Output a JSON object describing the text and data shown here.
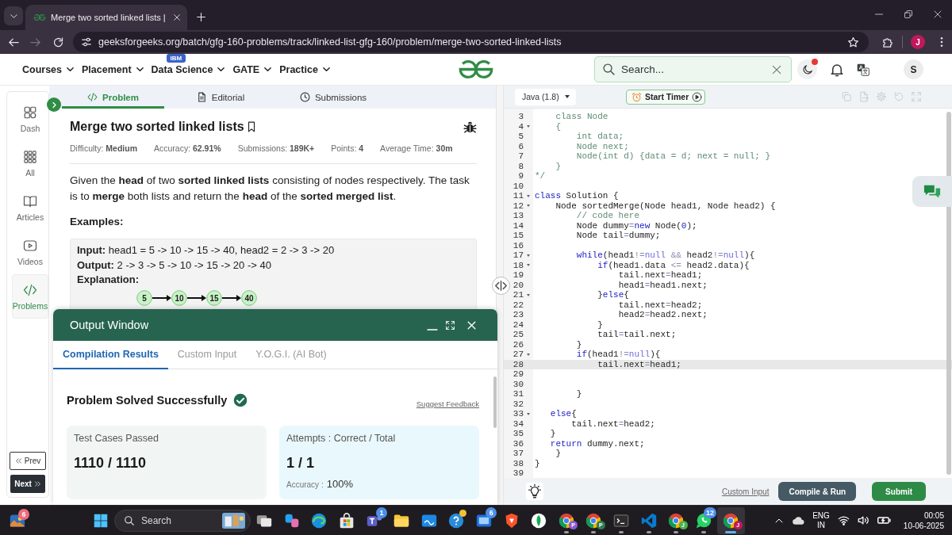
{
  "browser": {
    "tab_title": "Merge two sorted linked lists |",
    "nav": [
      {
        "kind": "back",
        "disabled": false
      },
      {
        "kind": "forward",
        "disabled": true
      },
      {
        "kind": "reload",
        "disabled": false
      }
    ],
    "url": "geeksforgeeks.org/batch/gfg-160-problems/track/linked-list-gfg-160/problem/merge-two-sorted-linked-lists",
    "profile": "J"
  },
  "site_nav": {
    "menu": [
      {
        "label": "Courses"
      },
      {
        "label": "Placement"
      },
      {
        "label": "Data Science",
        "badge": "IBM"
      },
      {
        "label": "GATE"
      },
      {
        "label": "Practice"
      }
    ],
    "search": {
      "placeholder": "Search..."
    },
    "theme_alert": true,
    "avatar": "S"
  },
  "sidebar": {
    "items": [
      {
        "kind": "dash",
        "label": "Dash",
        "selected": false
      },
      {
        "kind": "all",
        "label": "All",
        "selected": false
      },
      {
        "kind": "articles",
        "label": "Articles",
        "selected": false
      },
      {
        "kind": "videos",
        "label": "Videos",
        "selected": false
      },
      {
        "kind": "problems",
        "label": "Problems",
        "selected": true
      }
    ],
    "prev": "Prev",
    "next": "Next"
  },
  "problem": {
    "tabs": [
      {
        "kind": "problem",
        "label": "Problem",
        "selected": true
      },
      {
        "kind": "editorial",
        "label": "Editorial",
        "selected": false
      },
      {
        "kind": "submissions",
        "label": "Submissions",
        "selected": false
      }
    ],
    "title": "Merge two sorted linked lists",
    "meta": [
      "Difficulty: **Medium**",
      "Accuracy: **62.91%**",
      "Submissions: **189K+**",
      "Points: **4**",
      "Average Time: **30m**"
    ],
    "description": "Given the **head** of two **sorted linked lists** consisting of nodes respectively. The task is to **merge** both lists and return the **head** of the **sorted merged list**.",
    "examples_heading": "Examples:",
    "example": {
      "lines": [
        "**Input:** head1 = 5 -> 10 -> 15 -> 40, head2 = 2 -> 3 -> 20",
        "**Output:** 2 -> 3 -> 5 -> 10 -> 15 -> 20 -> 40"
      ],
      "explanation_heading": "Explanation:",
      "diagram_nodes": [
        "5",
        "10",
        "15",
        "40"
      ]
    }
  },
  "output_window": {
    "title": "Output Window",
    "tabs": [
      {
        "label": "Compilation Results",
        "selected": true
      },
      {
        "label": "Custom Input",
        "selected": false
      },
      {
        "label": "Y.O.G.I. (AI Bot)",
        "selected": false
      }
    ],
    "status": "Problem Solved Successfully",
    "feedback_link": "Suggest Feedback",
    "cards": [
      {
        "label": "Test Cases Passed",
        "value": "1110 / 1110"
      },
      {
        "label": "Attempts : Correct / Total",
        "value": "1 / 1",
        "accuracy_label": "Accuracy :",
        "accuracy_value": "100%"
      }
    ]
  },
  "editor": {
    "language": "Java (1.8)",
    "timer": "Start Timer",
    "lines": [
      {
        "number": "3",
        "foldable": false,
        "active": false,
        "tokens": [
          {
            "kind": "comment",
            "text": "    class Node"
          }
        ]
      },
      {
        "number": "4",
        "foldable": true,
        "active": false,
        "tokens": [
          {
            "kind": "comment",
            "text": "    {"
          }
        ]
      },
      {
        "number": "5",
        "foldable": false,
        "active": false,
        "tokens": [
          {
            "kind": "comment",
            "text": "        int data;"
          }
        ]
      },
      {
        "number": "6",
        "foldable": false,
        "active": false,
        "tokens": [
          {
            "kind": "comment",
            "text": "        Node next;"
          }
        ]
      },
      {
        "number": "7",
        "foldable": false,
        "active": false,
        "tokens": [
          {
            "kind": "comment",
            "text": "        Node(int d) {data = d; next = null; }"
          }
        ]
      },
      {
        "number": "8",
        "foldable": false,
        "active": false,
        "tokens": [
          {
            "kind": "comment",
            "text": "    }"
          }
        ]
      },
      {
        "number": "9",
        "foldable": false,
        "active": false,
        "tokens": [
          {
            "kind": "comment",
            "text": "*/"
          }
        ]
      },
      {
        "number": "10",
        "foldable": false,
        "active": false
      },
      {
        "number": "11",
        "foldable": true,
        "active": false,
        "tokens": [
          {
            "kind": "keyword",
            "text": "class"
          },
          {
            "kind": "plain",
            "text": " Solution {"
          }
        ]
      },
      {
        "number": "12",
        "foldable": true,
        "active": false,
        "tokens": [
          {
            "kind": "plain",
            "text": "    Node sortedMerge(Node head1, Node head2) {"
          }
        ]
      },
      {
        "number": "13",
        "foldable": false,
        "active": false,
        "tokens": [
          {
            "kind": "comment",
            "text": "        // code here"
          }
        ]
      },
      {
        "number": "14",
        "foldable": false,
        "active": false,
        "tokens": [
          {
            "kind": "plain",
            "text": "        Node dummy"
          },
          {
            "kind": "operator",
            "text": "="
          },
          {
            "kind": "keyword",
            "text": "new"
          },
          {
            "kind": "plain",
            "text": " Node("
          },
          {
            "kind": "number",
            "text": "0"
          },
          {
            "kind": "plain",
            "text": ");"
          }
        ]
      },
      {
        "number": "15",
        "foldable": false,
        "active": false,
        "tokens": [
          {
            "kind": "plain",
            "text": "        Node tail"
          },
          {
            "kind": "operator",
            "text": "="
          },
          {
            "kind": "plain",
            "text": "dummy;"
          }
        ]
      },
      {
        "number": "16",
        "foldable": false,
        "active": false
      },
      {
        "number": "17",
        "foldable": true,
        "active": false,
        "tokens": [
          {
            "kind": "keyword",
            "text": "        while"
          },
          {
            "kind": "plain",
            "text": "(head1"
          },
          {
            "kind": "operator",
            "text": "!="
          },
          {
            "kind": "constant",
            "text": "null"
          },
          {
            "kind": "operator",
            "text": " &&"
          },
          {
            "kind": "plain",
            "text": " head2"
          },
          {
            "kind": "operator",
            "text": "!="
          },
          {
            "kind": "constant",
            "text": "null"
          },
          {
            "kind": "plain",
            "text": "){"
          }
        ]
      },
      {
        "number": "18",
        "foldable": true,
        "active": false,
        "tokens": [
          {
            "kind": "keyword",
            "text": "            if"
          },
          {
            "kind": "plain",
            "text": "(head1.data "
          },
          {
            "kind": "operator",
            "text": "<="
          },
          {
            "kind": "plain",
            "text": " head2.data){"
          }
        ]
      },
      {
        "number": "19",
        "foldable": false,
        "active": false,
        "tokens": [
          {
            "kind": "plain",
            "text": "                tail.next"
          },
          {
            "kind": "operator",
            "text": "="
          },
          {
            "kind": "plain",
            "text": "head1;"
          }
        ]
      },
      {
        "number": "20",
        "foldable": false,
        "active": false,
        "tokens": [
          {
            "kind": "plain",
            "text": "                head1"
          },
          {
            "kind": "operator",
            "text": "="
          },
          {
            "kind": "plain",
            "text": "head1.next;"
          }
        ]
      },
      {
        "number": "21",
        "foldable": true,
        "active": false,
        "tokens": [
          {
            "kind": "plain",
            "text": "            }"
          },
          {
            "kind": "keyword",
            "text": "else"
          },
          {
            "kind": "plain",
            "text": "{"
          }
        ]
      },
      {
        "number": "22",
        "foldable": false,
        "active": false,
        "tokens": [
          {
            "kind": "plain",
            "text": "                tail.next"
          },
          {
            "kind": "operator",
            "text": "="
          },
          {
            "kind": "plain",
            "text": "head2;"
          }
        ]
      },
      {
        "number": "23",
        "foldable": false,
        "active": false,
        "tokens": [
          {
            "kind": "plain",
            "text": "                head2"
          },
          {
            "kind": "operator",
            "text": "="
          },
          {
            "kind": "plain",
            "text": "head2.next;"
          }
        ]
      },
      {
        "number": "24",
        "foldable": false,
        "active": false,
        "tokens": [
          {
            "kind": "plain",
            "text": "            }"
          }
        ]
      },
      {
        "number": "25",
        "foldable": false,
        "active": false,
        "tokens": [
          {
            "kind": "plain",
            "text": "            tail"
          },
          {
            "kind": "operator",
            "text": "="
          },
          {
            "kind": "plain",
            "text": "tail.next;"
          }
        ]
      },
      {
        "number": "26",
        "foldable": false,
        "active": false,
        "tokens": [
          {
            "kind": "plain",
            "text": "        }"
          }
        ]
      },
      {
        "number": "27",
        "foldable": true,
        "active": false,
        "tokens": [
          {
            "kind": "keyword",
            "text": "        if"
          },
          {
            "kind": "plain",
            "text": "(head1"
          },
          {
            "kind": "operator",
            "text": "!="
          },
          {
            "kind": "constant",
            "text": "null"
          },
          {
            "kind": "plain",
            "text": "){"
          }
        ]
      },
      {
        "number": "28",
        "foldable": false,
        "active": true,
        "tokens": [
          {
            "kind": "plain",
            "text": "            tail.next"
          },
          {
            "kind": "operator",
            "text": "="
          },
          {
            "kind": "plain",
            "text": "head1;"
          }
        ]
      },
      {
        "number": "29",
        "foldable": false,
        "active": false
      },
      {
        "number": "30",
        "foldable": false,
        "active": false
      },
      {
        "number": "31",
        "foldable": false,
        "active": false,
        "tokens": [
          {
            "kind": "plain",
            "text": "        }"
          }
        ]
      },
      {
        "number": "32",
        "foldable": false,
        "active": false
      },
      {
        "number": "33",
        "foldable": true,
        "active": false,
        "tokens": [
          {
            "kind": "keyword",
            "text": "   else"
          },
          {
            "kind": "plain",
            "text": "{"
          }
        ]
      },
      {
        "number": "34",
        "foldable": false,
        "active": false,
        "tokens": [
          {
            "kind": "plain",
            "text": "       tail.next"
          },
          {
            "kind": "operator",
            "text": "="
          },
          {
            "kind": "plain",
            "text": "head2;"
          }
        ]
      },
      {
        "number": "35",
        "foldable": false,
        "active": false,
        "tokens": [
          {
            "kind": "plain",
            "text": "   }"
          }
        ]
      },
      {
        "number": "36",
        "foldable": false,
        "active": false,
        "tokens": [
          {
            "kind": "keyword",
            "text": "   return"
          },
          {
            "kind": "plain",
            "text": " dummy.next;"
          }
        ]
      },
      {
        "number": "37",
        "foldable": false,
        "active": false,
        "tokens": [
          {
            "kind": "plain",
            "text": "    }"
          }
        ]
      },
      {
        "number": "38",
        "foldable": false,
        "active": false,
        "tokens": [
          {
            "kind": "plain",
            "text": "}"
          }
        ]
      },
      {
        "number": "39",
        "foldable": false,
        "active": false
      }
    ],
    "custom_input": "Custom Input",
    "run": "Compile & Run",
    "submit": "Submit"
  },
  "taskbar": {
    "widget_badge": "6",
    "search_placeholder": "Search",
    "apps": [
      {
        "kind": "task_view",
        "open": false,
        "selected": false,
        "alert": false
      },
      {
        "kind": "copilot",
        "open": false,
        "selected": false,
        "alert": false
      },
      {
        "kind": "edge",
        "open": false,
        "selected": false,
        "alert": false
      },
      {
        "kind": "store",
        "open": false,
        "selected": false,
        "alert": false
      },
      {
        "kind": "teams",
        "badge": "1",
        "open": false,
        "selected": false,
        "alert": false
      },
      {
        "kind": "files",
        "open": false,
        "selected": false,
        "alert": false
      },
      {
        "kind": "tile",
        "open": false,
        "selected": false,
        "alert": false
      },
      {
        "kind": "help",
        "open": false,
        "selected": false,
        "alert": true
      },
      {
        "kind": "window",
        "badge": "6",
        "open": false,
        "selected": false,
        "alert": false
      },
      {
        "kind": "brave",
        "open": false,
        "selected": false,
        "alert": false
      },
      {
        "kind": "leaf",
        "open": false,
        "selected": false,
        "alert": false
      },
      {
        "kind": "chrome",
        "profile": "P",
        "color": "#8b5cd6",
        "open": true,
        "selected": false,
        "alert": false
      },
      {
        "kind": "chrome",
        "profile": "P",
        "color": "#2e7d4f",
        "open": true,
        "selected": false,
        "alert": false
      },
      {
        "kind": "terminal",
        "open": true,
        "selected": false,
        "alert": false
      },
      {
        "kind": "vscode",
        "open": true,
        "selected": false,
        "alert": false
      },
      {
        "kind": "chrome",
        "profile": "J",
        "color": "#4caf50",
        "open": true,
        "selected": false,
        "alert": false
      },
      {
        "kind": "whatsapp",
        "badge": "12",
        "open": true,
        "selected": false,
        "alert": false
      },
      {
        "kind": "chrome",
        "profile": "J",
        "color": "#c2185b",
        "open": true,
        "selected": true,
        "alert": false
      }
    ],
    "language": "ENG",
    "region": "IN",
    "time": "00:05",
    "date": "10-06-2025"
  }
}
